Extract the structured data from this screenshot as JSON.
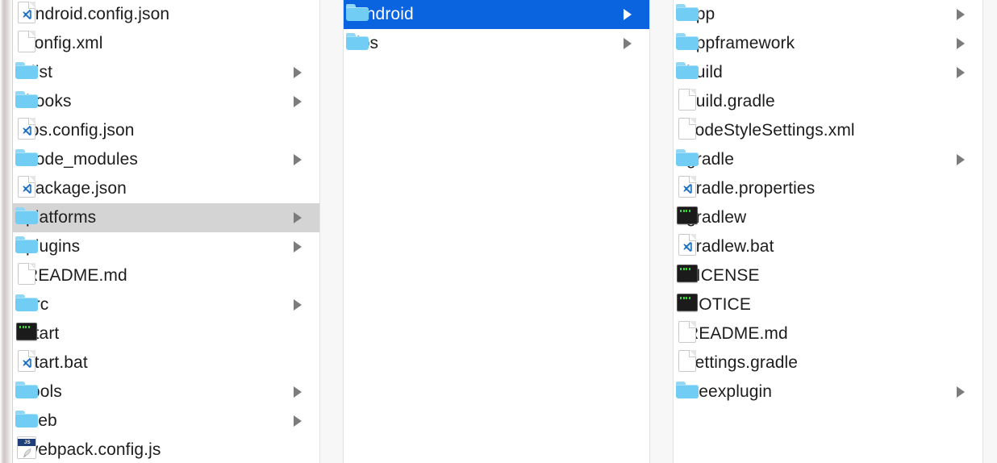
{
  "window": {
    "app": "Finder",
    "view": "column-view"
  },
  "colors": {
    "selection_active": "#0a64e0",
    "selection_inactive": "#d4d4d4",
    "folder": "#72cdf4",
    "text": "#1d1d1f",
    "text_selected": "#ffffff",
    "gutter": "#f7f7f7",
    "arrow": "#7c7c7c"
  },
  "columns": [
    {
      "name": "project-root-column",
      "items": [
        {
          "label": "android.config.json",
          "icon": "code-file-icon",
          "type": "file",
          "arrow": false,
          "state": "normal"
        },
        {
          "label": "config.xml",
          "icon": "document-icon",
          "type": "file",
          "arrow": false,
          "state": "normal"
        },
        {
          "label": "dist",
          "icon": "folder-icon",
          "type": "folder",
          "arrow": true,
          "state": "normal"
        },
        {
          "label": "hooks",
          "icon": "folder-icon",
          "type": "folder",
          "arrow": true,
          "state": "normal"
        },
        {
          "label": "ios.config.json",
          "icon": "code-file-icon",
          "type": "file",
          "arrow": false,
          "state": "normal"
        },
        {
          "label": "node_modules",
          "icon": "folder-icon",
          "type": "folder",
          "arrow": true,
          "state": "normal"
        },
        {
          "label": "package.json",
          "icon": "code-file-icon",
          "type": "file",
          "arrow": false,
          "state": "normal"
        },
        {
          "label": "platforms",
          "icon": "folder-icon",
          "type": "folder",
          "arrow": true,
          "state": "selected-inactive"
        },
        {
          "label": "plugins",
          "icon": "folder-icon",
          "type": "folder",
          "arrow": true,
          "state": "normal"
        },
        {
          "label": "README.md",
          "icon": "document-icon",
          "type": "file",
          "arrow": false,
          "state": "normal"
        },
        {
          "label": "src",
          "icon": "folder-icon",
          "type": "folder",
          "arrow": true,
          "state": "normal"
        },
        {
          "label": "start",
          "icon": "executable-icon",
          "type": "file",
          "arrow": false,
          "state": "normal"
        },
        {
          "label": "start.bat",
          "icon": "code-file-icon",
          "type": "file",
          "arrow": false,
          "state": "normal"
        },
        {
          "label": "tools",
          "icon": "folder-icon",
          "type": "folder",
          "arrow": true,
          "state": "normal"
        },
        {
          "label": "web",
          "icon": "folder-icon",
          "type": "folder",
          "arrow": true,
          "state": "normal"
        },
        {
          "label": "webpack.config.js",
          "icon": "js-file-icon",
          "type": "file",
          "arrow": false,
          "state": "normal"
        }
      ]
    },
    {
      "name": "platforms-column",
      "items": [
        {
          "label": "android",
          "icon": "folder-icon",
          "type": "folder",
          "arrow": true,
          "state": "selected-active"
        },
        {
          "label": "ios",
          "icon": "folder-icon",
          "type": "folder",
          "arrow": true,
          "state": "normal"
        }
      ]
    },
    {
      "name": "android-column",
      "items": [
        {
          "label": "app",
          "icon": "folder-icon",
          "type": "folder",
          "arrow": true,
          "state": "normal"
        },
        {
          "label": "appframework",
          "icon": "folder-icon",
          "type": "folder",
          "arrow": true,
          "state": "normal"
        },
        {
          "label": "build",
          "icon": "folder-icon",
          "type": "folder",
          "arrow": true,
          "state": "normal"
        },
        {
          "label": "build.gradle",
          "icon": "document-icon",
          "type": "file",
          "arrow": false,
          "state": "normal"
        },
        {
          "label": "codeStyleSettings.xml",
          "icon": "document-icon",
          "type": "file",
          "arrow": false,
          "state": "normal"
        },
        {
          "label": "gradle",
          "icon": "folder-icon",
          "type": "folder",
          "arrow": true,
          "state": "normal"
        },
        {
          "label": "gradle.properties",
          "icon": "code-file-icon",
          "type": "file",
          "arrow": false,
          "state": "normal"
        },
        {
          "label": "gradlew",
          "icon": "executable-icon",
          "type": "file",
          "arrow": false,
          "state": "normal"
        },
        {
          "label": "gradlew.bat",
          "icon": "code-file-icon",
          "type": "file",
          "arrow": false,
          "state": "normal"
        },
        {
          "label": "LICENSE",
          "icon": "executable-icon",
          "type": "file",
          "arrow": false,
          "state": "normal"
        },
        {
          "label": "NOTICE",
          "icon": "executable-icon",
          "type": "file",
          "arrow": false,
          "state": "normal"
        },
        {
          "label": "README.md",
          "icon": "document-icon",
          "type": "file",
          "arrow": false,
          "state": "normal"
        },
        {
          "label": "settings.gradle",
          "icon": "document-icon",
          "type": "file",
          "arrow": false,
          "state": "normal"
        },
        {
          "label": "weexplugin",
          "icon": "folder-icon",
          "type": "folder",
          "arrow": true,
          "state": "normal"
        }
      ]
    }
  ],
  "icon_glyphs": {
    "js_banner_text": "JS"
  }
}
